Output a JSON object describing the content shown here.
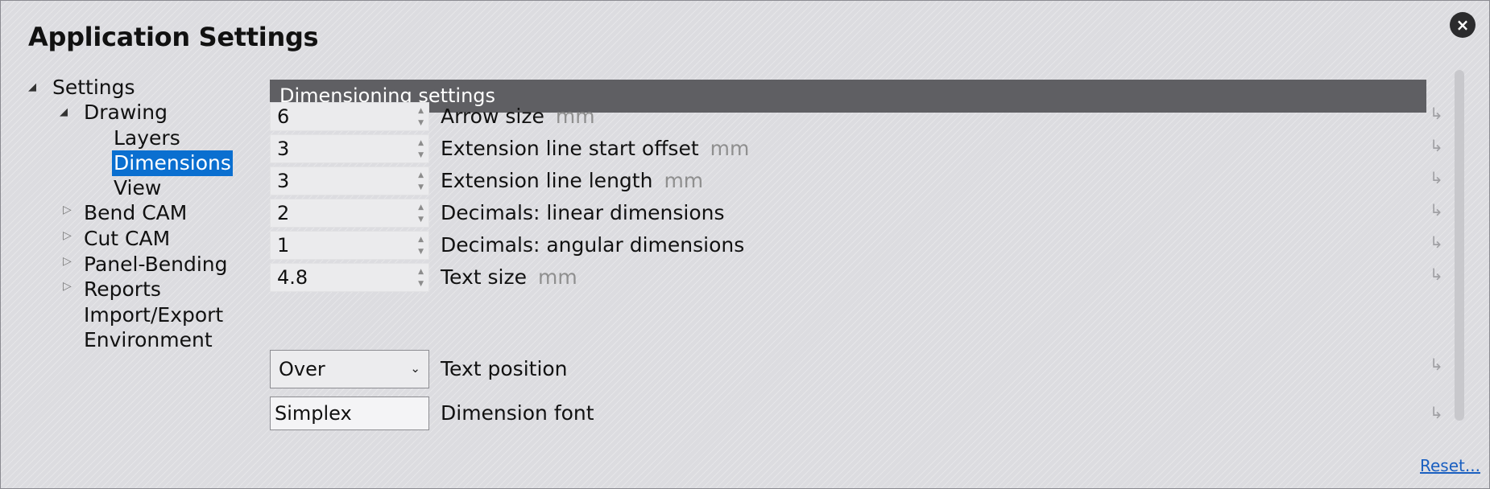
{
  "window": {
    "title": "Application Settings",
    "close_icon": "×"
  },
  "tree": {
    "collapsed_glyph": "▷",
    "expanded_glyph": "◢",
    "items": [
      {
        "label": "Settings",
        "state": "expanded"
      },
      {
        "label": "Drawing",
        "state": "expanded"
      },
      {
        "label": "Layers",
        "state": "leaf"
      },
      {
        "label": "Dimensions",
        "state": "leaf",
        "selected": true
      },
      {
        "label": "View",
        "state": "leaf"
      },
      {
        "label": "Bend CAM",
        "state": "collapsed"
      },
      {
        "label": "Cut CAM",
        "state": "collapsed"
      },
      {
        "label": "Panel-Bending",
        "state": "collapsed"
      },
      {
        "label": "Reports",
        "state": "collapsed"
      },
      {
        "label": "Import/Export",
        "state": "leaf"
      },
      {
        "label": "Environment",
        "state": "leaf"
      }
    ]
  },
  "section": {
    "title": "Dimensioning settings"
  },
  "settings": {
    "spin_up_glyph": "▲",
    "spin_down_glyph": "▼",
    "reset_arrow_glyph": "↳",
    "rows": [
      {
        "value": "6",
        "label": "Arrow size",
        "unit": "mm"
      },
      {
        "value": "3",
        "label": "Extension line start offset",
        "unit": "mm"
      },
      {
        "value": "3",
        "label": "Extension line length",
        "unit": "mm"
      },
      {
        "value": "2",
        "label": "Decimals: linear dimensions",
        "unit": ""
      },
      {
        "value": "1",
        "label": "Decimals: angular dimensions",
        "unit": ""
      },
      {
        "value": "4.8",
        "label": "Text size",
        "unit": "mm"
      }
    ],
    "text_position": {
      "value": "Over",
      "label": "Text position",
      "chevron": "⌄"
    },
    "dimension_font": {
      "value": "Simplex",
      "label": "Dimension font"
    }
  },
  "footer": {
    "reset_label": "Reset..."
  },
  "colors": {
    "selection": "#0a6fd0",
    "header_bg": "#5f5f63",
    "link": "#1a5fc0"
  }
}
